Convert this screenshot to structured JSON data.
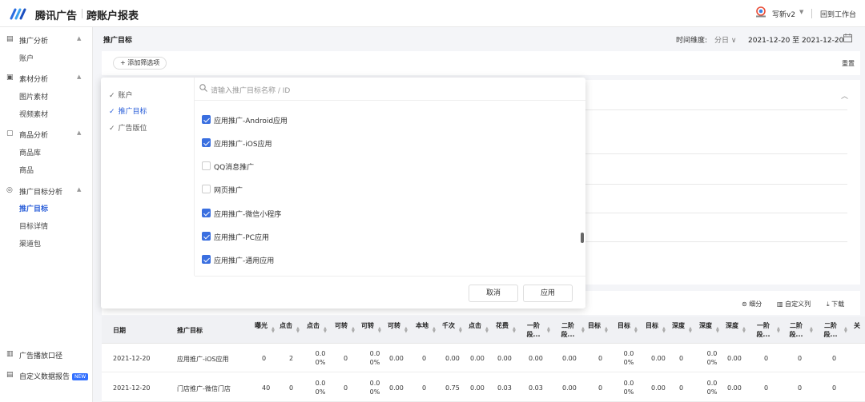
{
  "app": {
    "brand": "腾讯广告",
    "title": "跨账户报表",
    "user": "写新v2",
    "back_label": "回到工作台"
  },
  "sidebar": {
    "sections": [
      {
        "label": "推广分析",
        "icon": "report-icon",
        "items": [
          "账户"
        ]
      },
      {
        "label": "素材分析",
        "icon": "image-icon",
        "items": [
          "图片素材",
          "视频素材"
        ]
      },
      {
        "label": "商品分析",
        "icon": "bag-icon",
        "items": [
          "商品库",
          "商品"
        ]
      },
      {
        "label": "推广目标分析",
        "icon": "target-icon",
        "items": [
          "推广目标",
          "目标详情",
          "渠道包"
        ]
      }
    ],
    "bottom": [
      {
        "label": "广告播放口径",
        "icon": "chart-icon"
      },
      {
        "label": "自定义数据报告",
        "icon": "doc-icon",
        "badge": "NEW"
      }
    ]
  },
  "header": {
    "title": "推广目标",
    "dim_label": "时间维度:",
    "granularity": "分日",
    "date_range": "2021-12-20 至 2021-12-20"
  },
  "filter": {
    "add_label": "+ 添加筛选项",
    "reset_label": "重置"
  },
  "dropdown": {
    "categories": [
      "账户",
      "推广目标",
      "广告版位"
    ],
    "active_category": "推广目标",
    "search_placeholder": "请输入推广目标名称 / ID",
    "options": [
      {
        "label": "应用推广-Android应用",
        "checked": true
      },
      {
        "label": "应用推广-iOS应用",
        "checked": true
      },
      {
        "label": "QQ消息推广",
        "checked": false
      },
      {
        "label": "网页推广",
        "checked": false
      },
      {
        "label": "应用推广-微信小程序",
        "checked": true
      },
      {
        "label": "应用推广-PC应用",
        "checked": true
      },
      {
        "label": "应用推广-通用应用",
        "checked": true
      }
    ],
    "cancel_label": "取消",
    "apply_label": "应用"
  },
  "toolbar": {
    "breakdown": "细分",
    "custom_cols": "自定义列",
    "download": "下载"
  },
  "table": {
    "headers": [
      "日期",
      "推广目标",
      "曝光",
      "点击",
      "点击",
      "可转",
      "可转",
      "可转",
      "本地",
      "千次",
      "点击",
      "花费",
      "一阶段...",
      "二阶段...",
      "目标",
      "目标",
      "目标",
      "深度",
      "深度",
      "深度",
      "一阶段...",
      "二阶段...",
      "二阶段...",
      "关"
    ],
    "rows": [
      {
        "date": "2021-12-20",
        "target": "应用推广-iOS应用",
        "values": [
          "0",
          "2",
          "0.00%",
          "0",
          "0.00%",
          "0.00",
          "0",
          "0.00",
          "0.00",
          "0.00",
          "0.00",
          "0.00",
          "0",
          "0.00%",
          "0.00",
          "0",
          "0.00%",
          "0.00",
          "0",
          "0",
          "0"
        ]
      },
      {
        "date": "2021-12-20",
        "target": "门店推广-微信门店",
        "values": [
          "40",
          "0",
          "0.00%",
          "0",
          "0.00%",
          "0.00",
          "0",
          "0.75",
          "0.00",
          "0.03",
          "0.03",
          "0.00",
          "0",
          "0.00%",
          "0.00",
          "0",
          "0.00%",
          "0.00",
          "0",
          "0",
          "0"
        ]
      }
    ]
  }
}
